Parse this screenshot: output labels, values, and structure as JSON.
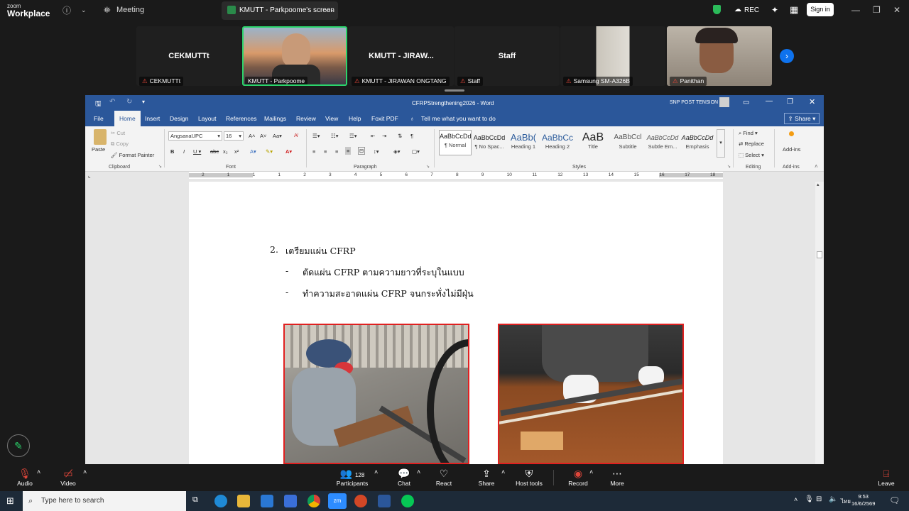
{
  "zoom": {
    "logo_small": "zoom",
    "logo_big": "Workplace",
    "meeting_label": "Meeting",
    "screen_tab": "KMUTT - Parkpoome's screen",
    "rec": "REC",
    "sign_in": "Sign in"
  },
  "participants": [
    {
      "name": "CEKMUTTt",
      "label": "CEKMUTTt"
    },
    {
      "name": "",
      "label": "KMUTT - Parkpoome"
    },
    {
      "name": "KMUTT - JIRAW...",
      "label": "KMUTT - JIRAWAN ONGTANG"
    },
    {
      "name": "Staff",
      "label": "Staff"
    },
    {
      "name": "",
      "label": "Samsung SM-A326B"
    },
    {
      "name": "",
      "label": "Panithan"
    }
  ],
  "word": {
    "title": "CFRPStrengthening2026  -  Word",
    "user": "SNP POST TENSION",
    "share": "Share",
    "tabs": [
      "File",
      "Home",
      "Insert",
      "Design",
      "Layout",
      "References",
      "Mailings",
      "Review",
      "View",
      "Help",
      "Foxit PDF"
    ],
    "tell_me": "Tell me what you want to do",
    "clipboard": {
      "paste": "Paste",
      "cut": "Cut",
      "copy": "Copy",
      "format_painter": "Format Painter",
      "group": "Clipboard"
    },
    "font": {
      "name": "AngsanaUPC",
      "size": "16",
      "group": "Font"
    },
    "paragraph_group": "Paragraph",
    "styles": [
      {
        "preview": "AaBbCcDd",
        "name": "¶ Normal"
      },
      {
        "preview": "AaBbCcDd",
        "name": "¶ No Spac..."
      },
      {
        "preview": "AaBb(",
        "name": "Heading 1"
      },
      {
        "preview": "AaBbCc",
        "name": "Heading 2"
      },
      {
        "preview": "AaB",
        "name": "Title"
      },
      {
        "preview": "AaBbCcl",
        "name": "Subtitle"
      },
      {
        "preview": "AaBbCcDd",
        "name": "Subtle Em..."
      },
      {
        "preview": "AaBbCcDd",
        "name": "Emphasis"
      }
    ],
    "styles_group": "Styles",
    "editing": {
      "find": "Find",
      "replace": "Replace",
      "select": "Select",
      "group": "Editing"
    },
    "addins": {
      "label": "Add-ins",
      "group": "Add-ins"
    },
    "ruler_numbers": [
      "2",
      "1",
      "1",
      "1",
      "2",
      "3",
      "4",
      "5",
      "6",
      "7",
      "8",
      "9",
      "10",
      "11",
      "12",
      "13",
      "14",
      "15",
      "16",
      "17",
      "18"
    ],
    "doc": {
      "heading_num": "2.",
      "heading": "เตรียมแผ่น CFRP",
      "bullet1": "ตัดแผ่น CFRP ตามความยาวที่ระบุในแบบ",
      "bullet2": "ทำความสะอาดแผ่น CFRP จนกระทั่งไม่มีฝุ่น",
      "dash": "-"
    }
  },
  "toolbar": {
    "audio": "Audio",
    "video": "Video",
    "participants": "Participants",
    "participants_count": "128",
    "chat": "Chat",
    "react": "React",
    "share": "Share",
    "host_tools": "Host tools",
    "record": "Record",
    "more": "More",
    "leave": "Leave"
  },
  "taskbar": {
    "search": "Type here to search",
    "time": "9:53",
    "date": "16/6/2569",
    "lang": "ไทย"
  },
  "colors": {
    "word_blue": "#2b579a",
    "zoom_bg": "#1a1a1a",
    "photo_border": "#e02020",
    "taskbar": "#1d2a38"
  }
}
